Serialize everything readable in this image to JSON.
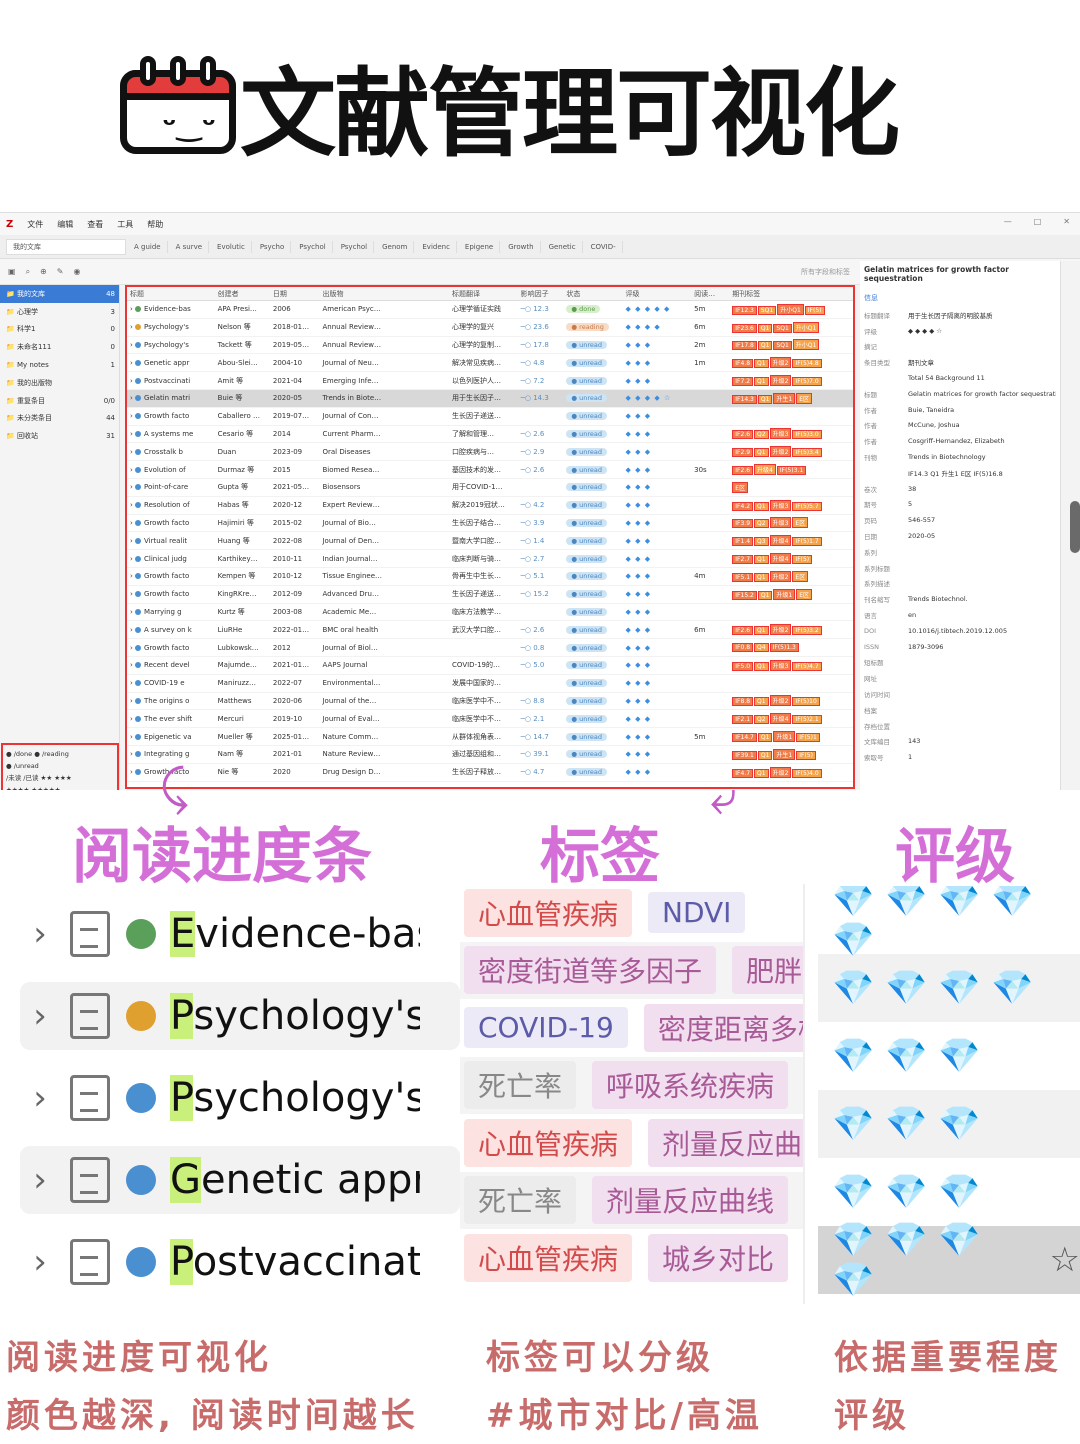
{
  "title": "文献管理可视化",
  "app": {
    "logo": "Z",
    "menu": [
      "文件",
      "编辑",
      "查看",
      "工具",
      "帮助"
    ],
    "window_controls": [
      "—",
      "□",
      "✕"
    ],
    "library_tab": "我的文库",
    "tabs": [
      "A guide",
      "A surve",
      "Evolutic",
      "Psycho",
      "Psychol",
      "Psychol",
      "Genom",
      "Evidenc",
      "Epigene",
      "Growth",
      "Genetic",
      "COVID-"
    ],
    "search_placeholder": "所有字段和标签",
    "left_tree": [
      {
        "label": "我的文库",
        "count": "48"
      },
      {
        "label": "心理学",
        "count": "3"
      },
      {
        "label": "科学1",
        "count": "0"
      },
      {
        "label": "未命名111",
        "count": "0"
      },
      {
        "label": "My notes",
        "count": "1"
      },
      {
        "label": "我的出版物",
        "count": ""
      },
      {
        "label": "重复条目",
        "count": "0/0"
      },
      {
        "label": "未分类条目",
        "count": "44"
      },
      {
        "label": "回收站",
        "count": "31"
      }
    ],
    "tag_legend": [
      "● /done  ● /reading",
      "● /unread",
      "/未读  /已读  ★★  ★★★",
      "★★★★  ★★★★★",
      "2019 ncov  项目  综合",
      "可疑期刊读  全文翻译",
      "借用阅读"
    ],
    "columns": [
      "标题",
      "创建者",
      "日期",
      "出版物",
      "",
      "标题翻译",
      "影响因子",
      "状态",
      "评级",
      "阅读…",
      "期刊标签"
    ],
    "rows": [
      {
        "title": "Evidence-bas",
        "creator": "APA Presi…",
        "date": "2006",
        "pub": "American Psyc…",
        "trans": "心理学循证实践",
        "progress": "12.3",
        "status": "done",
        "gems": "◆ ◆ ◆ ◆ ◆",
        "read": "5m",
        "tags": [
          "IF12.3",
          "SQ1",
          "升小Q1",
          "IF(5)"
        ],
        "dot": "#5aa05a"
      },
      {
        "title": "Psychology's",
        "creator": "Nelson 等",
        "date": "2018-01…",
        "pub": "Annual Review…",
        "trans": "心理学的复兴",
        "progress": "23.6",
        "status": "reading",
        "gems": "◆ ◆ ◆ ◆",
        "read": "6m",
        "tags": [
          "IF23.6",
          "Q1",
          "SQ1",
          "升小Q1"
        ],
        "dot": "#e0a030"
      },
      {
        "title": "Psychology's",
        "creator": "Tackett 等",
        "date": "2019-05…",
        "pub": "Annual Review…",
        "trans": "心理学的复制…",
        "progress": "17.8",
        "status": "unread",
        "gems": "◆ ◆ ◆",
        "read": "2m",
        "tags": [
          "IF17.8",
          "Q1",
          "SQ1",
          "升小Q1"
        ],
        "dot": "#4a90d0"
      },
      {
        "title": "Genetic appr",
        "creator": "Abou-Slei…",
        "date": "2004-10",
        "pub": "Journal of Neu…",
        "trans": "解决常见疾病…",
        "progress": "4.8",
        "status": "unread",
        "gems": "◆ ◆ ◆",
        "read": "1m",
        "tags": [
          "IF4.8",
          "Q1",
          "升级2",
          "IF(5)4.8"
        ],
        "dot": "#4a90d0"
      },
      {
        "title": "Postvaccinati",
        "creator": "Amit 等",
        "date": "2021-04",
        "pub": "Emerging Infe…",
        "trans": "以色列医护人…",
        "progress": "7.2",
        "status": "unread",
        "gems": "◆ ◆ ◆",
        "read": "",
        "tags": [
          "IF7.2",
          "Q1",
          "升级2",
          "IF(5)7.0"
        ],
        "dot": "#4a90d0"
      },
      {
        "title": "Gelatin matri",
        "creator": "Buie 等",
        "date": "2020-05",
        "pub": "Trends in Biote…",
        "trans": "用于生长因子…",
        "progress": "14.3",
        "status": "unread",
        "gems": "◆ ◆ ◆ ◆ ☆",
        "read": "",
        "tags": [
          "IF14.3",
          "Q1",
          "升生1",
          "E区"
        ],
        "dot": "#4a90d0"
      },
      {
        "title": "Growth facto",
        "creator": "Caballero …",
        "date": "2019-07…",
        "pub": "Journal of Con…",
        "trans": "生长因子递送…",
        "progress": "",
        "status": "unread",
        "gems": "◆ ◆ ◆",
        "read": "",
        "tags": [],
        "dot": "#4a90d0"
      },
      {
        "title": "A systems me",
        "creator": "Cesario 等",
        "date": "2014",
        "pub": "Current Pharm…",
        "trans": "了解和管理…",
        "progress": "2.6",
        "status": "unread",
        "gems": "◆ ◆ ◆",
        "read": "",
        "tags": [
          "IF2.6",
          "Q2",
          "升级3",
          "IF(5)3.0"
        ],
        "dot": "#4a90d0"
      },
      {
        "title": "Crosstalk b",
        "creator": "Duan",
        "date": "2023-09",
        "pub": "Oral Diseases",
        "trans": "口腔疾病与…",
        "progress": "2.9",
        "status": "unread",
        "gems": "◆ ◆ ◆",
        "read": "",
        "tags": [
          "IF2.9",
          "Q1",
          "升级2",
          "IF(5)3.4"
        ],
        "dot": "#4a90d0"
      },
      {
        "title": "Evolution of",
        "creator": "Durmaz 等",
        "date": "2015",
        "pub": "Biomed Resea…",
        "trans": "基因技术的发…",
        "progress": "2.6",
        "status": "unread",
        "gems": "◆ ◆ ◆",
        "read": "30s",
        "tags": [
          "IF2.6",
          "升级4",
          "IF(5)3.1"
        ],
        "dot": "#4a90d0"
      },
      {
        "title": "Point-of-care",
        "creator": "Gupta 等",
        "date": "2021-05…",
        "pub": "Biosensors",
        "trans": "用于COVID-1…",
        "progress": "",
        "status": "unread",
        "gems": "◆ ◆ ◆",
        "read": "",
        "tags": [
          "E区"
        ],
        "dot": "#4a90d0"
      },
      {
        "title": "Resolution of",
        "creator": "Habas 等",
        "date": "2020-12",
        "pub": "Expert Review…",
        "trans": "解决2019冠状…",
        "progress": "4.2",
        "status": "unread",
        "gems": "◆ ◆ ◆",
        "read": "",
        "tags": [
          "IF4.2",
          "Q1",
          "升级3",
          "IF(5)5.7"
        ],
        "dot": "#4a90d0"
      },
      {
        "title": "Growth facto",
        "creator": "Hajimiri 等",
        "date": "2015-02",
        "pub": "Journal of Bio…",
        "trans": "生长因子结合…",
        "progress": "3.9",
        "status": "unread",
        "gems": "◆ ◆ ◆",
        "read": "",
        "tags": [
          "IF3.9",
          "Q2",
          "升级3",
          "E区"
        ],
        "dot": "#4a90d0"
      },
      {
        "title": "Virtual realit",
        "creator": "Huang 等",
        "date": "2022-08",
        "pub": "Journal of Den…",
        "trans": "暨南大学口腔…",
        "progress": "1.4",
        "status": "unread",
        "gems": "◆ ◆ ◆",
        "read": "",
        "tags": [
          "IF1.4",
          "Q3",
          "升级4",
          "IF(5)1.7"
        ],
        "dot": "#4a90d0"
      },
      {
        "title": "Clinical judg",
        "creator": "Karthikey…",
        "date": "2010-11",
        "pub": "Indian Journal…",
        "trans": "临床判断与骑…",
        "progress": "2.7",
        "status": "unread",
        "gems": "◆ ◆ ◆",
        "read": "",
        "tags": [
          "IF2.7",
          "Q1",
          "升级4",
          "IF(5)"
        ],
        "dot": "#4a90d0"
      },
      {
        "title": "Growth facto",
        "creator": "Kempen 等",
        "date": "2010-12",
        "pub": "Tissue Enginee…",
        "trans": "骨再生中生长…",
        "progress": "5.1",
        "status": "unread",
        "gems": "◆ ◆ ◆",
        "read": "4m",
        "tags": [
          "IF5.1",
          "Q1",
          "升级2",
          "E区"
        ],
        "dot": "#4a90d0"
      },
      {
        "title": "Growth facto",
        "creator": "KingRKre…",
        "date": "2012-09",
        "pub": "Advanced Dru…",
        "trans": "生长因子递送…",
        "progress": "15.2",
        "status": "unread",
        "gems": "◆ ◆ ◆",
        "read": "",
        "tags": [
          "IF15.2",
          "Q1",
          "升级1",
          "E区"
        ],
        "dot": "#4a90d0"
      },
      {
        "title": "Marrying g",
        "creator": "Kurtz 等",
        "date": "2003-08",
        "pub": "Academic Me…",
        "trans": "临床方法教学…",
        "progress": "",
        "status": "unread",
        "gems": "◆ ◆ ◆",
        "read": "",
        "tags": [],
        "dot": "#4a90d0"
      },
      {
        "title": "A survey on k",
        "creator": "LiuRHe",
        "date": "2022-01…",
        "pub": "BMC oral health",
        "trans": "武汉大学口腔…",
        "progress": "2.6",
        "status": "unread",
        "gems": "◆ ◆ ◆",
        "read": "6m",
        "tags": [
          "IF2.6",
          "Q1",
          "升级2",
          "IF(5)3.2"
        ],
        "dot": "#4a90d0"
      },
      {
        "title": "Growth facto",
        "creator": "Lubkowsk…",
        "date": "2012",
        "pub": "Journal of Biol…",
        "trans": "",
        "progress": "0.8",
        "status": "unread",
        "gems": "◆ ◆ ◆",
        "read": "",
        "tags": [
          "IF0.8",
          "Q4",
          "IF(5)1.3"
        ],
        "dot": "#4a90d0"
      },
      {
        "title": "Recent devel",
        "creator": "Majumde…",
        "date": "2021-01…",
        "pub": "AAPS Journal",
        "trans": "COVID-19的…",
        "progress": "5.0",
        "status": "unread",
        "gems": "◆ ◆ ◆",
        "read": "",
        "tags": [
          "IF5.0",
          "Q1",
          "升级3",
          "IF(5)4.7"
        ],
        "dot": "#4a90d0"
      },
      {
        "title": "COVID-19 e",
        "creator": "Maniruzz…",
        "date": "2022-07",
        "pub": "Environmental…",
        "trans": "发展中国家的…",
        "progress": "",
        "status": "unread",
        "gems": "◆ ◆ ◆",
        "read": "",
        "tags": [],
        "dot": "#4a90d0"
      },
      {
        "title": "The origins o",
        "creator": "Matthews",
        "date": "2020-06",
        "pub": "Journal of the…",
        "trans": "临床医学中不…",
        "progress": "8.8",
        "status": "unread",
        "gems": "◆ ◆ ◆",
        "read": "",
        "tags": [
          "IF8.8",
          "Q1",
          "升级2",
          "IF(5)10"
        ],
        "dot": "#4a90d0"
      },
      {
        "title": "The ever shift",
        "creator": "Mercuri",
        "date": "2019-10",
        "pub": "Journal of Eval…",
        "trans": "临床医学中不…",
        "progress": "2.1",
        "status": "unread",
        "gems": "◆ ◆ ◆",
        "read": "",
        "tags": [
          "IF2.1",
          "Q2",
          "升级4",
          "IF(5)2.1"
        ],
        "dot": "#4a90d0"
      },
      {
        "title": "Epigenetic va",
        "creator": "Mueller 等",
        "date": "2025-01…",
        "pub": "Nature Comm…",
        "trans": "从群体视角表…",
        "progress": "14.7",
        "status": "unread",
        "gems": "◆ ◆ ◆",
        "read": "5m",
        "tags": [
          "IF14.7",
          "Q1",
          "升级1",
          "IF(5)1"
        ],
        "dot": "#4a90d0"
      },
      {
        "title": "Integrating g",
        "creator": "Nam 等",
        "date": "2021-01",
        "pub": "Nature Review…",
        "trans": "通过基因组和…",
        "progress": "39.1",
        "status": "unread",
        "gems": "◆ ◆ ◆",
        "read": "",
        "tags": [
          "IF39.1",
          "Q1",
          "升生1",
          "IF(5)"
        ],
        "dot": "#4a90d0"
      },
      {
        "title": "Growth facto",
        "creator": "Nie 等",
        "date": "2020",
        "pub": "Drug Design D…",
        "trans": "生长因子释放…",
        "progress": "4.7",
        "status": "unread",
        "gems": "◆ ◆ ◆",
        "read": "",
        "tags": [
          "IF4.7",
          "Q1",
          "升级2",
          "IF(5)4.0"
        ],
        "dot": "#4a90d0"
      }
    ],
    "info_panel": {
      "title": "Gelatin matrices for growth factor sequestration",
      "section": "信息",
      "fields": [
        {
          "k": "标题翻译",
          "v": "用于生长因子隔离的明胶基质"
        },
        {
          "k": "评级",
          "v": "◆ ◆ ◆ ◆ ☆"
        },
        {
          "k": "摘记",
          "v": ""
        },
        {
          "k": "条目类型",
          "v": "期刊文章"
        },
        {
          "k": "",
          "v": "Total 54  Background 11"
        },
        {
          "k": "标题",
          "v": "Gelatin matrices for growth factor sequestration"
        },
        {
          "k": "作者",
          "v": "Buie, Taneidra"
        },
        {
          "k": "作者",
          "v": "McCune, Joshua"
        },
        {
          "k": "作者",
          "v": "Cosgriff-Hernandez, Elizabeth"
        },
        {
          "k": "刊物",
          "v": "Trends in Biotechnology"
        },
        {
          "k": "",
          "v": "IF14.3  Q1  升生1  E区  IF(5)16.8"
        },
        {
          "k": "卷次",
          "v": "38"
        },
        {
          "k": "期号",
          "v": "5"
        },
        {
          "k": "页码",
          "v": "546-557"
        },
        {
          "k": "日期",
          "v": "2020-05"
        },
        {
          "k": "系列",
          "v": ""
        },
        {
          "k": "系列标题",
          "v": ""
        },
        {
          "k": "系列描述",
          "v": ""
        },
        {
          "k": "刊名缩写",
          "v": "Trends Biotechnol."
        },
        {
          "k": "语言",
          "v": "en"
        },
        {
          "k": "DOI",
          "v": "10.1016/j.tibtech.2019.12.005"
        },
        {
          "k": "ISSN",
          "v": "1879-3096"
        },
        {
          "k": "短标题",
          "v": ""
        },
        {
          "k": "网址",
          "v": ""
        },
        {
          "k": "访问时间",
          "v": ""
        },
        {
          "k": "档案",
          "v": ""
        },
        {
          "k": "存档位置",
          "v": ""
        },
        {
          "k": "文库编目",
          "v": "143"
        },
        {
          "k": "索取号",
          "v": "1"
        }
      ]
    }
  },
  "labels": {
    "progress": "阅读进度条",
    "tags": "标签",
    "rating": "评级"
  },
  "zoom_left": [
    {
      "title": "Evidence-bas",
      "dot": "#5aa05a"
    },
    {
      "title": "Psychology's",
      "dot": "#e0a030"
    },
    {
      "title": "Psychology's",
      "dot": "#4a90d0"
    },
    {
      "title": "Genetic appro",
      "dot": "#4a90d0"
    },
    {
      "title": "Postvaccinati",
      "dot": "#4a90d0"
    }
  ],
  "zoom_tags": [
    [
      {
        "t": "心血管疾病",
        "c": "red"
      },
      {
        "t": "NDVI",
        "c": "blue"
      }
    ],
    [
      {
        "t": "密度街道等多因子",
        "c": "pink"
      },
      {
        "t": "肥胖",
        "c": "pink"
      }
    ],
    [
      {
        "t": "COVID-19",
        "c": "blue"
      },
      {
        "t": "密度距离多样",
        "c": "pink"
      }
    ],
    [
      {
        "t": "死亡率",
        "c": "gry"
      },
      {
        "t": "呼吸系统疾病",
        "c": "pink"
      }
    ],
    [
      {
        "t": "心血管疾病",
        "c": "red"
      },
      {
        "t": "剂量反应曲线",
        "c": "pink"
      }
    ],
    [
      {
        "t": "死亡率",
        "c": "gry"
      },
      {
        "t": "剂量反应曲线",
        "c": "pink"
      }
    ],
    [
      {
        "t": "心血管疾病",
        "c": "red"
      },
      {
        "t": "城乡对比",
        "c": "pink"
      }
    ]
  ],
  "zoom_ratings": [
    {
      "gems": "💎 💎 💎 💎 💎",
      "star": ""
    },
    {
      "gems": "💎 💎 💎 💎",
      "star": ""
    },
    {
      "gems": "💎 💎 💎",
      "star": ""
    },
    {
      "gems": "💎 💎 💎",
      "star": ""
    },
    {
      "gems": "💎 💎 💎",
      "star": ""
    },
    {
      "gems": "💎 💎 💎 💎",
      "star": "☆"
    }
  ],
  "captions": {
    "c1a": "阅读进度可视化",
    "c1b": "颜色越深, 阅读时间越长",
    "c2a": "标签可以分级",
    "c2b": "#城市对比/高温",
    "c3a": "依据重要程度",
    "c3b": "评级"
  },
  "icons": [
    "calendar-smile-icon",
    "arrow-curve-icon",
    "gem-icon",
    "star-icon",
    "chevron-icon",
    "document-icon"
  ]
}
